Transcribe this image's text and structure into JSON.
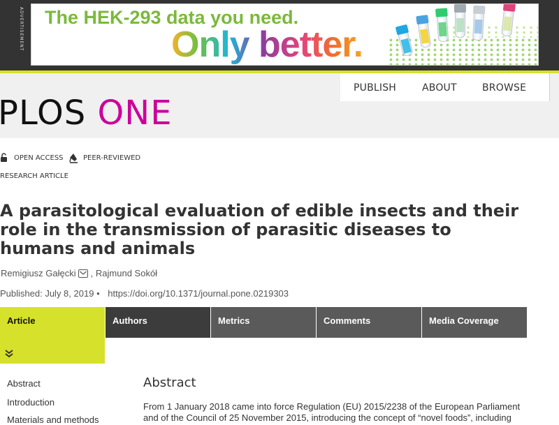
{
  "ad": {
    "label": "Advertisement",
    "headline": "The HEK-293 data you need.",
    "tagline": "Only better."
  },
  "header": {
    "logo_part1": "PLOS",
    "logo_part2": "ONE",
    "nav": [
      "PUBLISH",
      "ABOUT",
      "BROWSE"
    ]
  },
  "article": {
    "access_badge": "OPEN ACCESS",
    "review_badge": "PEER-REVIEWED",
    "type": "RESEARCH ARTICLE",
    "title": "A parasitological evaluation of edible insects and their role in the transmission of parasitic diseases to humans and animals",
    "authors": [
      "Remigiusz Gałęcki",
      "Rajmund Sokół"
    ],
    "published": "Published: July 8, 2019",
    "doi": "https://doi.org/10.1371/journal.pone.0219303"
  },
  "tabs": [
    "Article",
    "Authors",
    "Metrics",
    "Comments",
    "Media Coverage"
  ],
  "sidebar": {
    "links": [
      "Abstract",
      "Introduction",
      "Materials and methods"
    ]
  },
  "content": {
    "abstract_heading": "Abstract",
    "abstract_text": "From 1 January 2018 came into force Regulation (EU) 2015/2238 of the European Parliament and of the Council of 25 November 2015, introducing the concept of “novel foods”, including"
  },
  "colors": {
    "accent": "#d6e12b",
    "brand_magenta": "#cc0099",
    "tab_dark": "#3c3c3c",
    "tab_mid": "#5a5a5a"
  },
  "icons": [
    "lock-open-icon",
    "pen-nib-icon",
    "email-icon",
    "chevron-double-down-icon"
  ]
}
